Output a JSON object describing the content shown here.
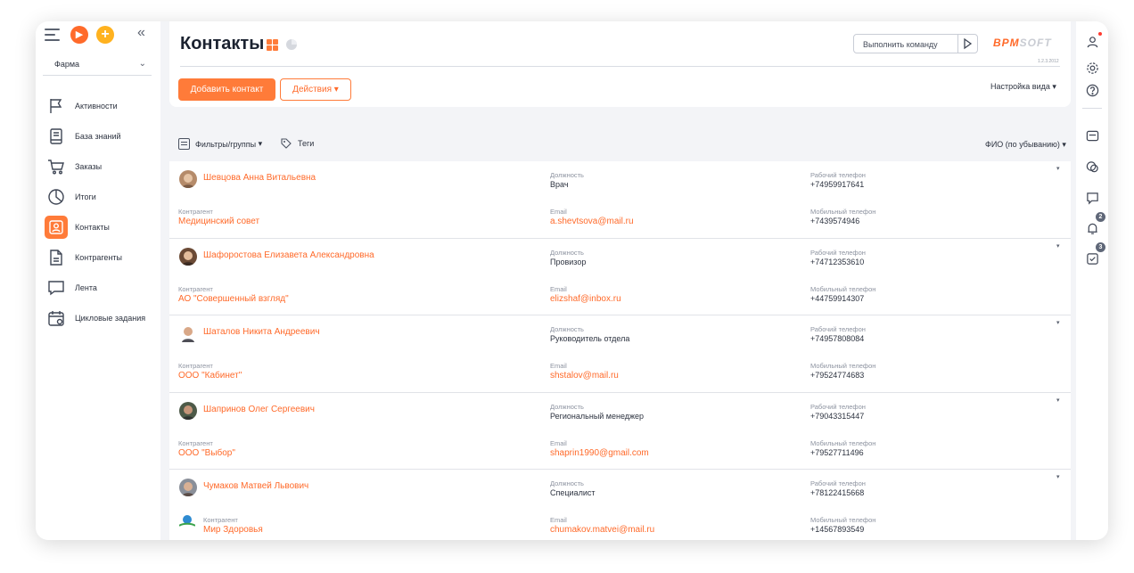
{
  "workspace": "Фарма",
  "sidebar": {
    "items": [
      {
        "label": "Активности",
        "icon": "flag-icon"
      },
      {
        "label": "База знаний",
        "icon": "book-icon"
      },
      {
        "label": "Заказы",
        "icon": "cart-icon"
      },
      {
        "label": "Итоги",
        "icon": "pie-chart-icon"
      },
      {
        "label": "Контакты",
        "icon": "contact-card-icon",
        "active": true
      },
      {
        "label": "Контрагенты",
        "icon": "document-icon"
      },
      {
        "label": "Лента",
        "icon": "chat-bubble-icon"
      },
      {
        "label": "Цикловые задания",
        "icon": "calendar-icon"
      }
    ]
  },
  "header": {
    "title": "Контакты",
    "command_placeholder": "Выполнить команду",
    "brand_accent": "BPM",
    "brand_rest": "SOFT",
    "version": "1.2.3.2012",
    "add_button": "Добавить контакт",
    "actions_button": "Действия",
    "view_settings": "Настройка вида"
  },
  "toolbar": {
    "filters": "Фильтры/группы",
    "tags": "Теги",
    "sort": "ФИО (по убыванию)"
  },
  "labels": {
    "position": "Должность",
    "work_phone": "Рабочий телефон",
    "account": "Контрагент",
    "email": "Email",
    "mobile_phone": "Мобильный телефон"
  },
  "contacts": [
    {
      "name": "Шевцова Анна Витальевна",
      "position": "Врач",
      "work_phone": "+74959917641",
      "account": "Медицинский совет",
      "email": "a.shevtsova@mail.ru",
      "mobile_phone": "+7439574946"
    },
    {
      "name": "Шафоростова Елизавета Александровна",
      "position": "Провизор",
      "work_phone": "+74712353610",
      "account": "АО \"Совершенный взгляд\"",
      "email": "elizshaf@inbox.ru",
      "mobile_phone": "+44759914307"
    },
    {
      "name": "Шаталов Никита Андреевич",
      "position": "Руководитель отдела",
      "work_phone": "+74957808084",
      "account": "ООО \"Кабинет\"",
      "email": "shstalov@mail.ru",
      "mobile_phone": "+79524774683"
    },
    {
      "name": "Шапринов Олег Сергеевич",
      "position": "Региональный менеджер",
      "work_phone": "+79043315447",
      "account": "ООО \"Выбор\"",
      "email": "shaprin1990@gmail.com",
      "mobile_phone": "+79527711496"
    },
    {
      "name": "Чумаков Матвей Львович",
      "position": "Специалист",
      "work_phone": "+78122415668",
      "account": "Мир Здоровья",
      "email": "chumakov.matvei@mail.ru",
      "mobile_phone": "+14567893549"
    }
  ],
  "rail": {
    "notifications_count": "2",
    "tasks_count": "3"
  },
  "colors": {
    "accent": "#ff7b39",
    "link": "#ff6a2a"
  }
}
